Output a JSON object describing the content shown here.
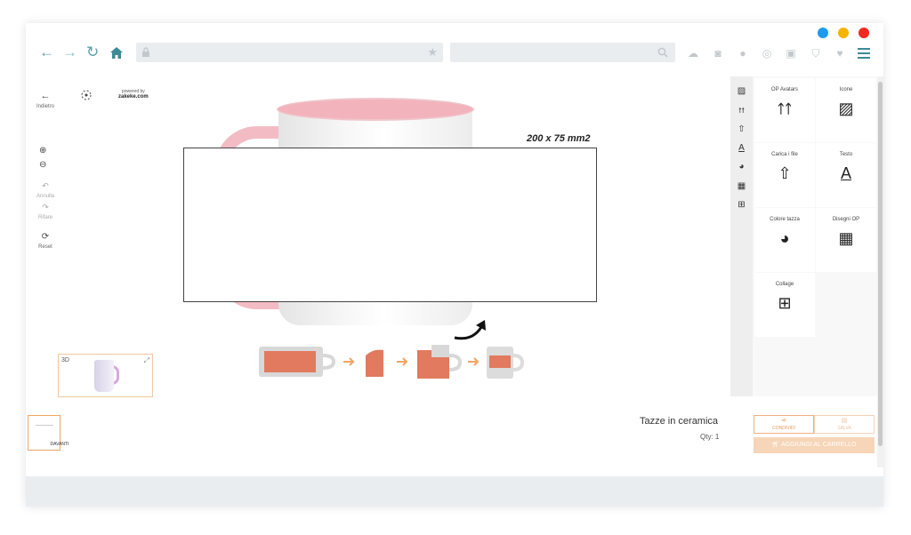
{
  "browser": {
    "window_controls": [
      {
        "name": "minimize",
        "color": "#1e9bf0"
      },
      {
        "name": "maximize",
        "color": "#f5b400"
      },
      {
        "name": "close",
        "color": "#f0281e"
      }
    ],
    "nav_icons": [
      "back-arrow-icon",
      "forward-arrow-icon",
      "reload-icon",
      "home-icon"
    ],
    "toolbar_icons": [
      "cloud-icon",
      "camera-icon",
      "alert-icon",
      "podcast-icon",
      "briefcase-icon",
      "shield-icon",
      "heart-icon",
      "menu-icon"
    ]
  },
  "left_tools": {
    "back_label": "Indietro",
    "powered_by": "powered by",
    "powered_brand": "zakeke.com",
    "undo_label": "Annulla",
    "redo_label": "Rifare",
    "reset_label": "Reset"
  },
  "canvas": {
    "print_size": "200 x 75 mm2",
    "mug_rim_color": "#f3b3bc",
    "mug_handle_color": "#f3bcc4",
    "preview_3d_label": "3D"
  },
  "tools_panel": {
    "cards": [
      {
        "label": "OP Avatars",
        "icon": "avatars-icon"
      },
      {
        "label": "Icone",
        "icon": "image-icon"
      },
      {
        "label": "Carica i file",
        "icon": "upload-icon"
      },
      {
        "label": "Testo",
        "icon": "text-icon"
      },
      {
        "label": "Colore tazza",
        "icon": "palette-icon"
      },
      {
        "label": "Disegni OP",
        "icon": "layout-icon"
      },
      {
        "label": "Collage",
        "icon": "grid-icon"
      }
    ]
  },
  "bottom": {
    "view_label": "DAVANTI",
    "product_name": "Tazze in ceramica",
    "qty": "Qty: 1",
    "share_label": "CONDIVIDI",
    "save_label": "SALVA",
    "cart_label": "AGGIUNGI AL CARRELLO",
    "accent_color": "#e59a55"
  }
}
